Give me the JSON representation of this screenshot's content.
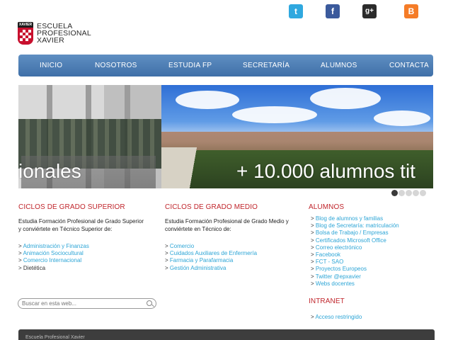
{
  "social": {
    "twitter": "t",
    "facebook": "f",
    "googleplus": "g+",
    "blogger": "B"
  },
  "logo": {
    "crest_text": "XAVIER",
    "line1": "ESCUELA",
    "line2": "PROFESIONAL",
    "line3": "XAVIER"
  },
  "nav": {
    "items": [
      "INICIO",
      "NOSOTROS",
      "ESTUDIA FP",
      "SECRETARÍA",
      "ALUMNOS",
      "CONTACTA"
    ]
  },
  "slider": {
    "caption_left": "ionales",
    "caption_right": "+ 10.000 alumnos tit",
    "slide_count": 5,
    "active_slide": 1
  },
  "columns": {
    "superior": {
      "title": "CICLOS DE GRADO SUPERIOR",
      "description": "Estudia Formación Profesional de Grado Superior y conviértete en Técnico Superior de:",
      "items": [
        "Administración y Finanzas",
        "Animación Sociocultural",
        "Comercio Internacional",
        "Dietética"
      ]
    },
    "medio": {
      "title": "CICLOS DE GRADO MEDIO",
      "description": "Estudia Formación Profesional de Grado Medio y conviértete en Técnico de:",
      "items": [
        "Comercio",
        "Cuidados Auxiliares de Enfermería",
        "Farmacia y Parafarmacia",
        "Gestión Administrativa"
      ]
    },
    "alumnos": {
      "title": "ALUMNOS",
      "items": [
        "Blog de alumnos y familias",
        "Blog de Secretaría: matriculación",
        "Bolsa de Trabajo / Empresas",
        "Certificados Microsoft Office",
        "Correo electrónico",
        "Facebook",
        "FCT - SAO",
        "Proyectos Europeos",
        "Twitter @epxavier",
        "Webs docentes"
      ]
    },
    "intranet": {
      "title": "INTRANET",
      "items": [
        "Acceso restringido"
      ]
    }
  },
  "search": {
    "placeholder": "Buscar en esta web..."
  },
  "footer": {
    "text": "Escuela Profesional Xavier"
  },
  "colors": {
    "nav": "#4a7cb4",
    "heading": "#c0262c",
    "link": "#2da5d6",
    "footer": "#3d3d3d"
  }
}
